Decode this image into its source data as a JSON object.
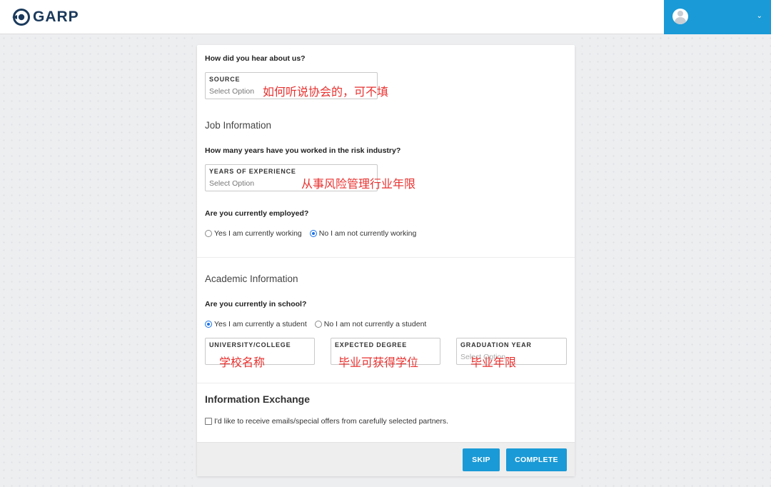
{
  "header": {
    "logo_text": "GARP",
    "chevron": "⌄"
  },
  "hear_about": {
    "question": "How did you hear about us?",
    "source_label": "SOURCE",
    "source_value": "Select Option",
    "annotation": "如何听说协会的，可不填"
  },
  "job": {
    "title": "Job Information",
    "years_question": "How many years have you worked in the risk industry?",
    "years_label": "YEARS OF EXPERIENCE",
    "years_value": "Select Option",
    "years_annotation": "从事风险管理行业年限",
    "employed_question": "Are you currently employed?",
    "employed_yes": "Yes I am currently working",
    "employed_no": "No I am not currently working",
    "employed_selected": "no"
  },
  "academic": {
    "title": "Academic Information",
    "school_question": "Are you currently in school?",
    "school_yes": "Yes I am currently a student",
    "school_no": "No I am not currently a student",
    "school_selected": "yes",
    "university_label": "UNIVERSITY/COLLEGE",
    "university_annotation": "学校名称",
    "degree_label": "EXPECTED DEGREE",
    "degree_annotation": "毕业可获得学位",
    "grad_label": "GRADUATION YEAR",
    "grad_value": "Select Option",
    "grad_annotation": "毕业年限"
  },
  "exchange": {
    "title": "Information Exchange",
    "checkbox_label": "I'd like to receive emails/special offers from carefully selected partners.",
    "checked": false
  },
  "buttons": {
    "skip": "SKIP",
    "complete": "COMPLETE"
  },
  "colors": {
    "accent": "#1a9ad6",
    "annotation": "#e8312f",
    "logo": "#1b3a5c"
  }
}
